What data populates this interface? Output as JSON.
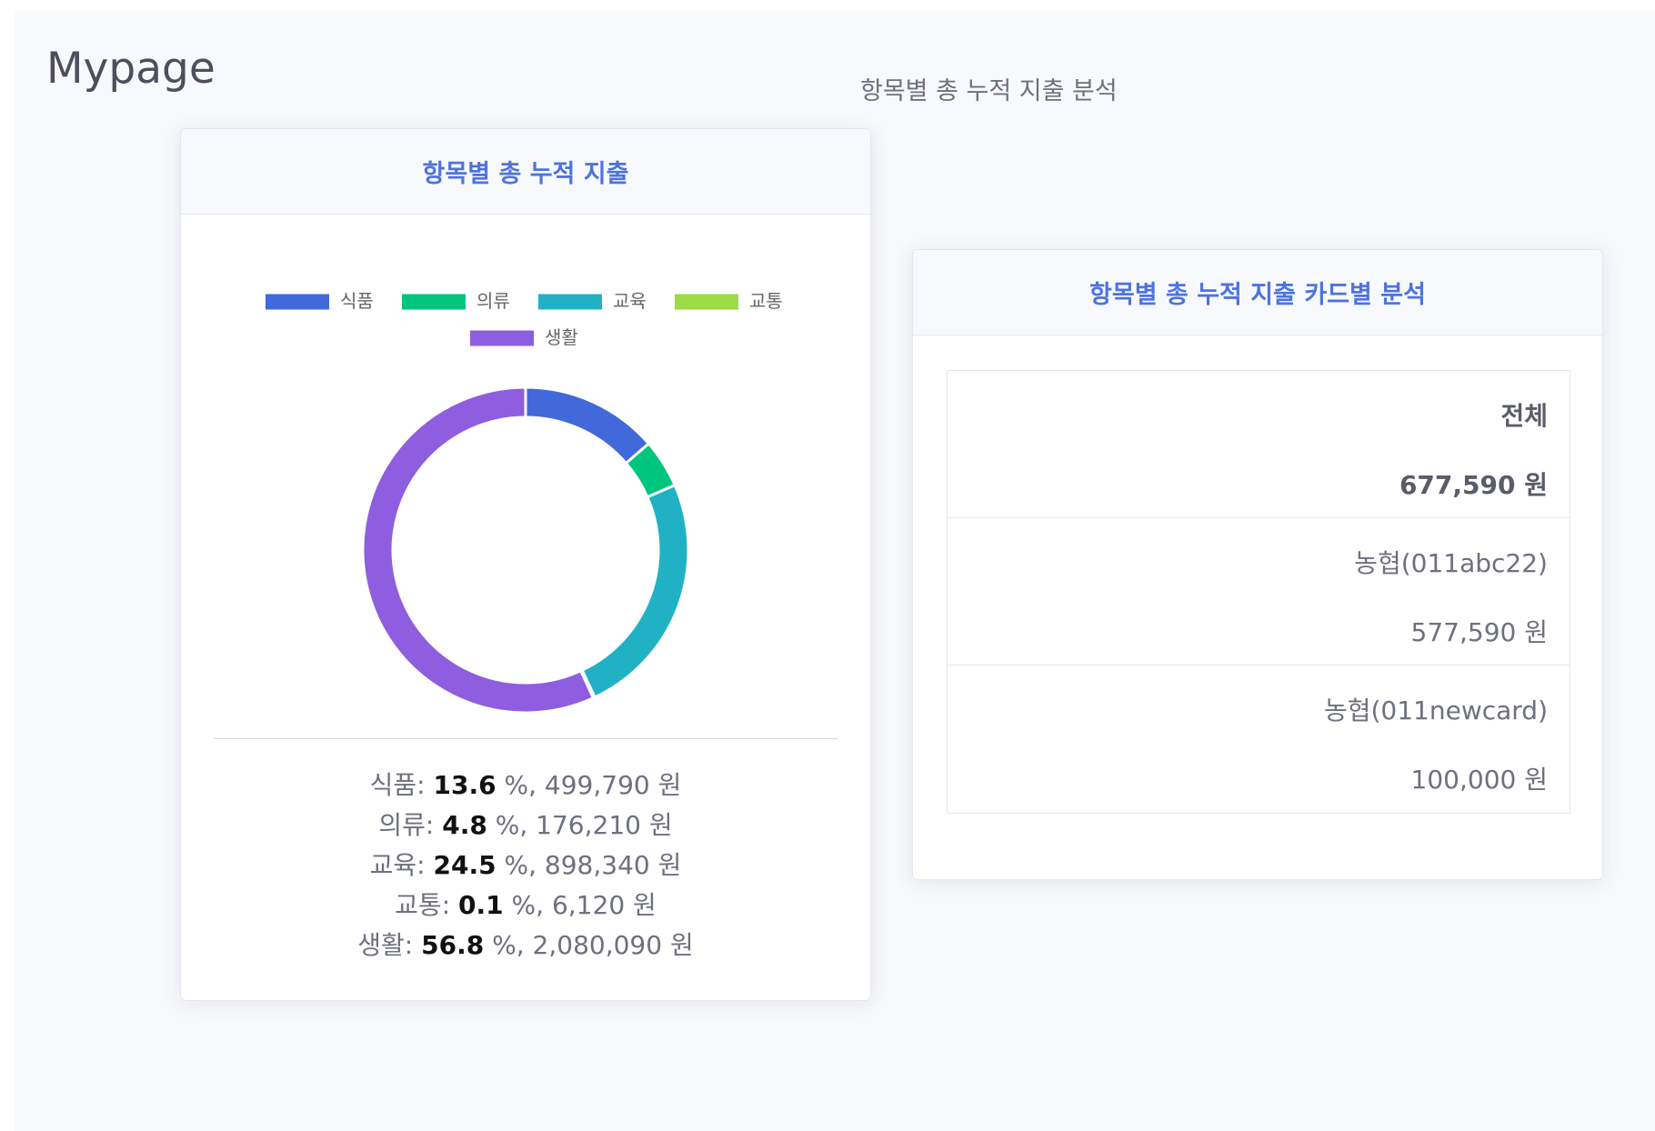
{
  "page": {
    "title": "Mypage",
    "subtitle": "항목별 총 누적 지출 분석"
  },
  "chart_card": {
    "header": "항목별 총 누적 지출"
  },
  "chart_data": {
    "type": "pie",
    "style": "doughnut",
    "legend_position": "top",
    "categories": [
      "식품",
      "의류",
      "교육",
      "교통",
      "생활"
    ],
    "values": [
      499790,
      176210,
      898340,
      6120,
      2080090
    ],
    "percents": [
      13.6,
      4.8,
      24.5,
      0.1,
      56.8
    ],
    "colors": [
      "#4169d9",
      "#00c57e",
      "#20b2c4",
      "#9bdc45",
      "#8f5ddf"
    ]
  },
  "summary": [
    {
      "label": "식품",
      "percent": "13.6",
      "amount": "499,790"
    },
    {
      "label": "의류",
      "percent": "4.8",
      "amount": "176,210"
    },
    {
      "label": "교육",
      "percent": "24.5",
      "amount": "898,340"
    },
    {
      "label": "교통",
      "percent": "0.1",
      "amount": "6,120"
    },
    {
      "label": "생활",
      "percent": "56.8",
      "amount": "2,080,090"
    }
  ],
  "summary_format": {
    "separator": ": ",
    "percent_suffix": " %, ",
    "currency_suffix": " 원"
  },
  "card_table": {
    "header": "항목별 총 누적 지출 카드별 분석",
    "rows": [
      {
        "label": "전체",
        "amount": "677,590 원"
      },
      {
        "label": "농협(011abc22)",
        "amount": "577,590 원"
      },
      {
        "label": "농협(011newcard)",
        "amount": "100,000 원"
      }
    ]
  }
}
